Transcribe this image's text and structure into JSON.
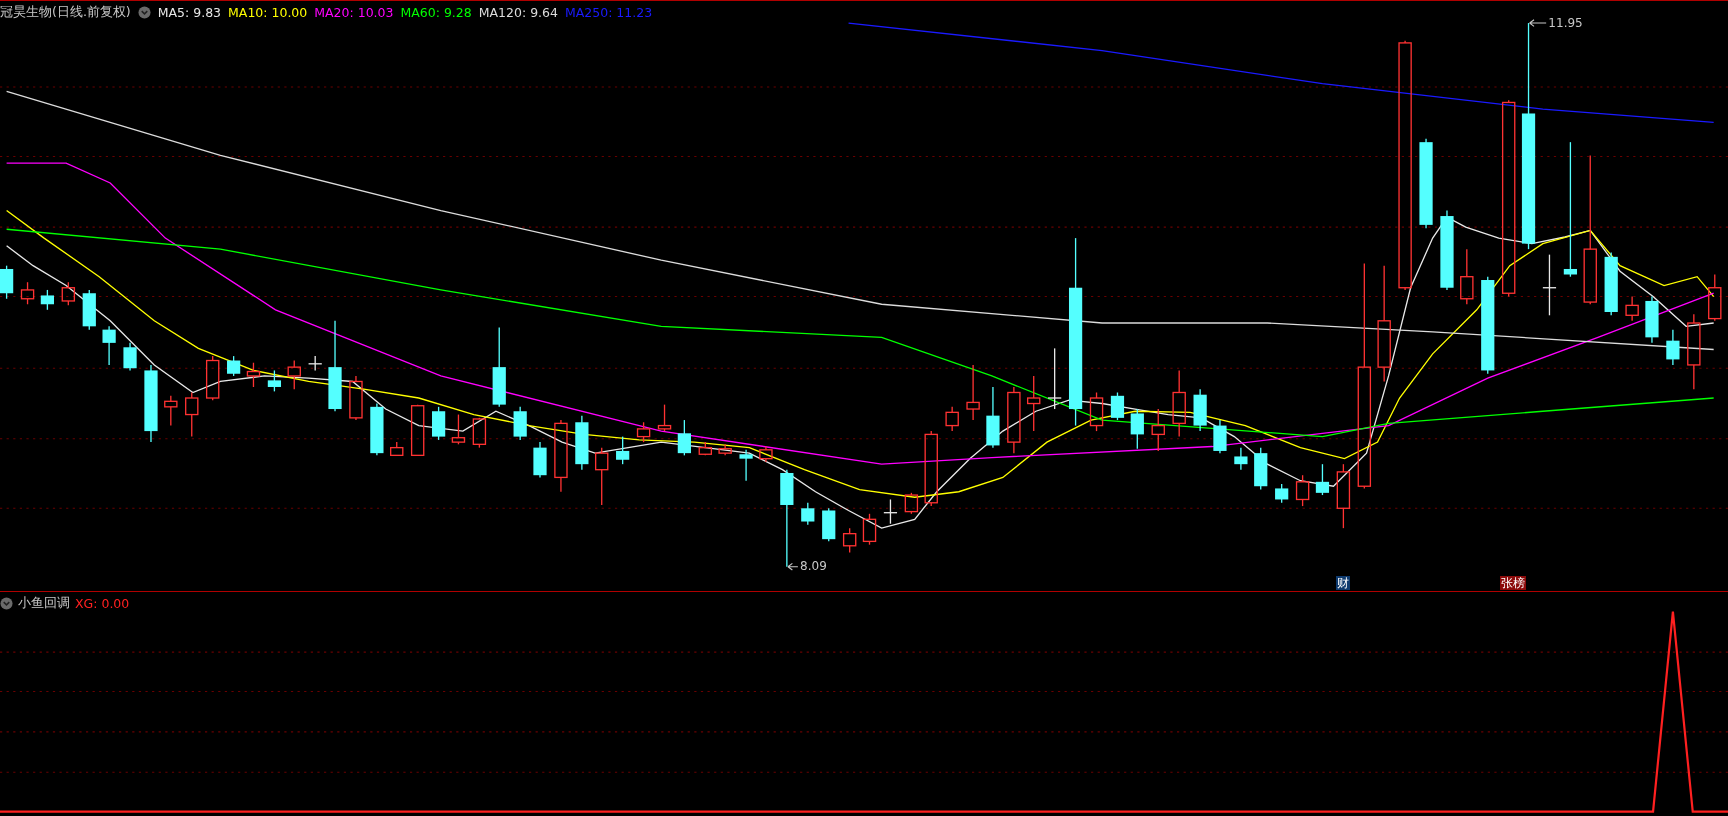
{
  "main_panel": {
    "title": "冠昊生物(日线.前复权)",
    "moving_averages": [
      {
        "label": "MA5: 9.83",
        "color": "#e8e8e8"
      },
      {
        "label": "MA10: 10.00",
        "color": "#ffff00"
      },
      {
        "label": "MA20: 10.03",
        "color": "#ff00ff"
      },
      {
        "label": "MA60: 9.28",
        "color": "#00ff00"
      },
      {
        "label": "MA120: 9.64",
        "color": "#dcdcdc"
      },
      {
        "label": "MA250: 11.23",
        "color": "#1a1aff"
      }
    ],
    "price_labels": [
      {
        "text": "11.95",
        "kind": "high"
      },
      {
        "text": "8.09",
        "kind": "low"
      }
    ],
    "event_marks": [
      {
        "text": "财",
        "color": "#0e3a6e"
      },
      {
        "text": "张榜",
        "color": "#8b0a0a"
      }
    ]
  },
  "indicator_panel": {
    "title": "小鱼回调",
    "reading": "XG: 0.00"
  }
}
